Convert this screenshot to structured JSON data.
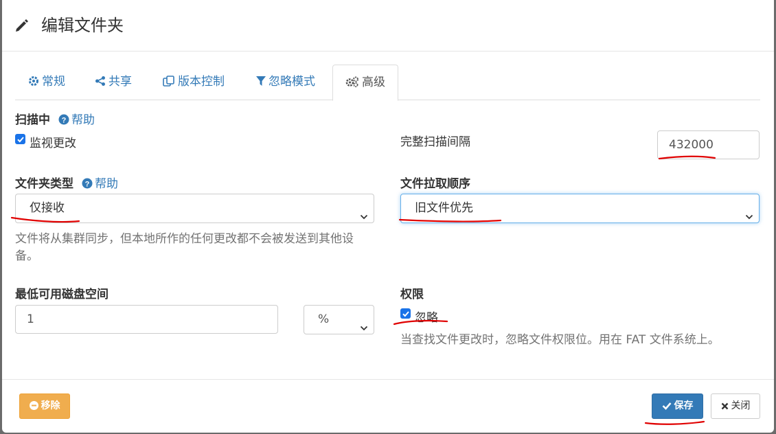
{
  "dialog": {
    "title": "编辑文件夹"
  },
  "tabs": [
    {
      "label": "常规",
      "icon": "gear-icon"
    },
    {
      "label": "共享",
      "icon": "share-icon"
    },
    {
      "label": "版本控制",
      "icon": "copy-icon"
    },
    {
      "label": "忽略模式",
      "icon": "filter-icon"
    },
    {
      "label": "高级",
      "icon": "cogs-icon",
      "active": true
    }
  ],
  "scanning": {
    "heading": "扫描中",
    "help": "帮助",
    "watch_label": "监视更改",
    "watch_checked": true,
    "rescan_label": "完整扫描间隔",
    "rescan_value": "432000"
  },
  "folder_type": {
    "heading": "文件夹类型",
    "help": "帮助",
    "value": "仅接收",
    "description_line1": "文件将从集群同步，但本地所作的任何更改都不会被发送到其他设",
    "description_line2": "备。"
  },
  "pull_order": {
    "heading": "文件拉取顺序",
    "value": "旧文件优先"
  },
  "min_disk_free": {
    "heading": "最低可用磁盘空间",
    "value": "1",
    "unit": "%"
  },
  "permissions": {
    "heading": "权限",
    "ignore_label": "忽略",
    "ignore_checked": true,
    "description": "当查找文件更改时，忽略文件权限位。用在 FAT 文件系统上。"
  },
  "footer": {
    "remove_label": "移除",
    "save_label": "保存",
    "close_label": "关闭"
  },
  "colors": {
    "link": "#337ab7",
    "primary": "#337ab7",
    "warning": "#f0ad4e",
    "annotation": "#e00000"
  }
}
